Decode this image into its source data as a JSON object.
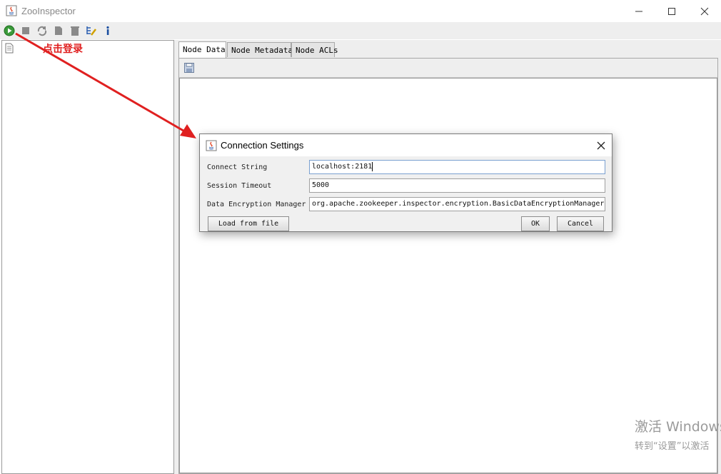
{
  "window": {
    "title": "ZooInspector"
  },
  "toolbar": {
    "items": [
      {
        "icon": "connect-icon"
      },
      {
        "icon": "disconnect-icon"
      },
      {
        "icon": "refresh-icon"
      },
      {
        "icon": "add-node-icon"
      },
      {
        "icon": "delete-node-icon"
      },
      {
        "icon": "node-viewers-icon"
      },
      {
        "icon": "about-icon"
      }
    ]
  },
  "annotation": {
    "text": "点击登录",
    "color": "#e02020"
  },
  "tabs": [
    "Node Data",
    "Node Metadata",
    "Node ACLs"
  ],
  "active_tab": "Node Data",
  "dialog": {
    "title": "Connection Settings",
    "fields": [
      {
        "label": "Connect String",
        "value": "localhost:2181"
      },
      {
        "label": "Session Timeout",
        "value": "5000"
      },
      {
        "label": "Data Encryption Manager",
        "value": "org.apache.zookeeper.inspector.encryption.BasicDataEncryptionManager"
      }
    ],
    "load_button": "Load from file",
    "ok_button": "OK",
    "cancel_button": "Cancel"
  },
  "watermark": {
    "line1": "激活 Windows",
    "line2": "转到“设置”以激活"
  }
}
